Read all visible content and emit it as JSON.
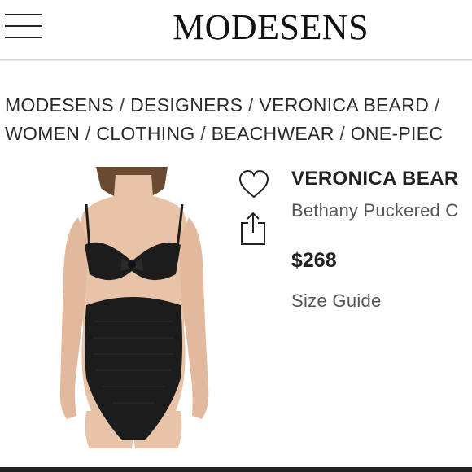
{
  "header": {
    "logo": "MODESENS",
    "menu_icon": "hamburger-menu-icon"
  },
  "breadcrumb": {
    "line1": [
      "MODESENS",
      "DESIGNERS",
      "VERONICA BEARD"
    ],
    "line2": [
      "WOMEN",
      "CLOTHING",
      "BEACHWEAR",
      "ONE-PIEC"
    ],
    "separator": "/"
  },
  "product": {
    "brand": "VERONICA BEAR",
    "name": "Bethany Puckered C",
    "price": "$268",
    "size_guide": "Size Guide",
    "image_alt": "black one-piece swimsuit with cutout and front bow",
    "favorite_icon": "heart-icon",
    "share_icon": "share-icon"
  },
  "colors": {
    "text": "#222222",
    "muted": "#555555",
    "swimsuit": "#1c1c1c",
    "skin": "#e8c3a8"
  }
}
